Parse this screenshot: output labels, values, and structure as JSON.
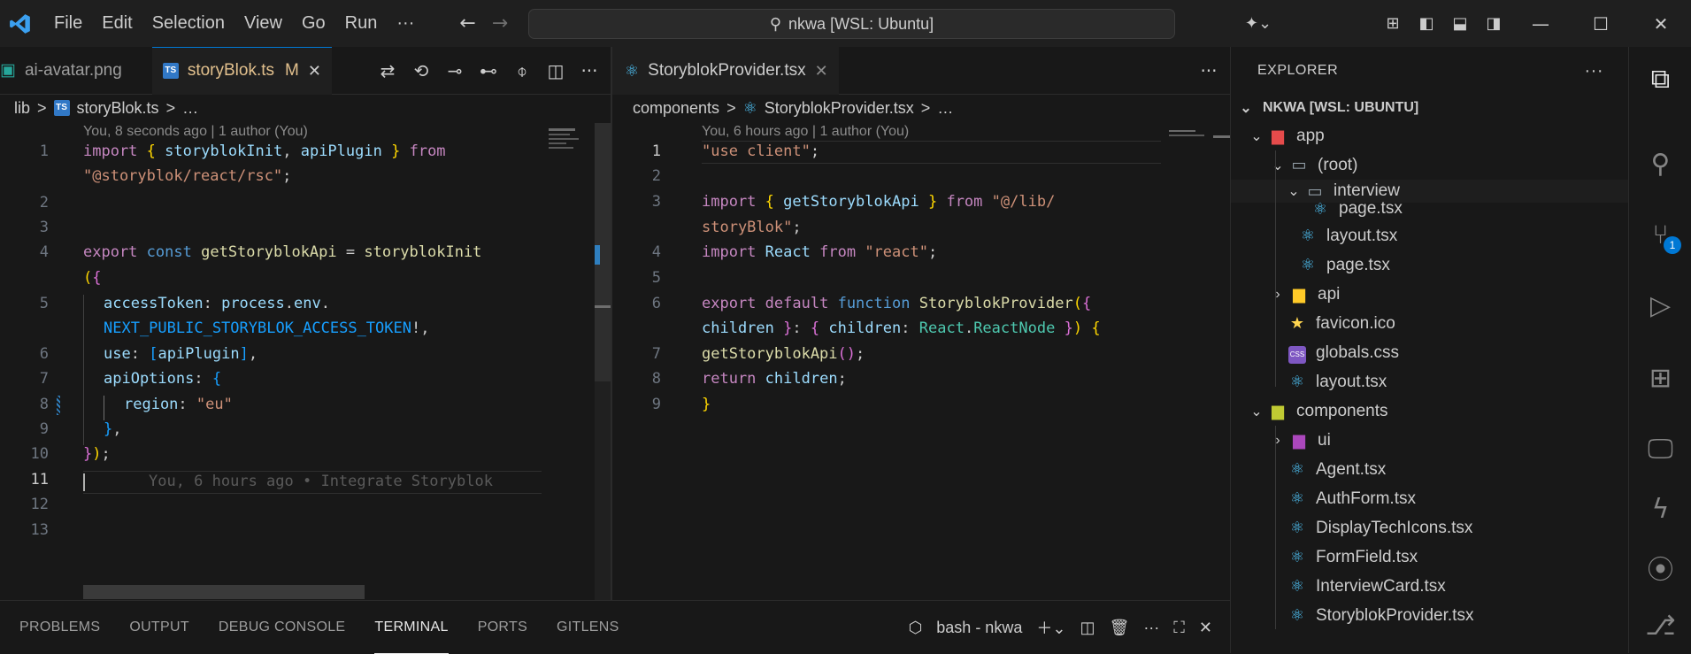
{
  "menu": [
    "File",
    "Edit",
    "Selection",
    "View",
    "Go",
    "Run",
    "···"
  ],
  "command_center": "nkwa [WSL: Ubuntu]",
  "left_editor": {
    "tabs": [
      {
        "label": "ai-avatar.png"
      },
      {
        "label": "storyBlok.ts",
        "modified": "M"
      }
    ],
    "breadcrumb": [
      "lib",
      ">",
      "storyBlok.ts",
      ">",
      "…"
    ],
    "blame_header": "You, 8 seconds ago | 1 author (You)",
    "lines": [
      "1",
      "",
      "2",
      "3",
      "4",
      "",
      "5",
      "",
      "6",
      "7",
      "8",
      "9",
      "10",
      "11",
      "12",
      "13"
    ],
    "inline_blame": "You, 6 hours ago • Integrate Storyblok"
  },
  "right_editor": {
    "tab": "StoryblokProvider.tsx",
    "breadcrumb": [
      "components",
      ">",
      "StoryblokProvider.tsx",
      ">",
      "…"
    ],
    "blame_header": "You, 6 hours ago | 1 author (You)",
    "lines": [
      "1",
      "2",
      "3",
      "",
      "4",
      "5",
      "6",
      "",
      "7",
      "8",
      "9"
    ]
  },
  "panel": {
    "tabs": [
      "PROBLEMS",
      "OUTPUT",
      "DEBUG CONSOLE",
      "TERMINAL",
      "PORTS",
      "GITLENS"
    ],
    "terminal_name": "bash - nkwa"
  },
  "explorer": {
    "title": "EXPLORER",
    "root": "NKWA [WSL: UBUNTU]",
    "items": [
      {
        "label": "app"
      },
      {
        "label": "(root)"
      },
      {
        "label": "interview"
      },
      {
        "label": "page.tsx"
      },
      {
        "label": "layout.tsx"
      },
      {
        "label": "page.tsx"
      },
      {
        "label": "api"
      },
      {
        "label": "favicon.ico"
      },
      {
        "label": "globals.css"
      },
      {
        "label": "layout.tsx"
      },
      {
        "label": "components"
      },
      {
        "label": "ui"
      },
      {
        "label": "Agent.tsx"
      },
      {
        "label": "AuthForm.tsx"
      },
      {
        "label": "DisplayTechIcons.tsx"
      },
      {
        "label": "FormField.tsx"
      },
      {
        "label": "InterviewCard.tsx"
      },
      {
        "label": "StoryblokProvider.tsx"
      }
    ]
  },
  "source_control_badge": "1",
  "colors": {
    "accent": "#0078d4",
    "modified": "#e2c08d",
    "string": "#ce9178",
    "keyword": "#c586c0"
  }
}
